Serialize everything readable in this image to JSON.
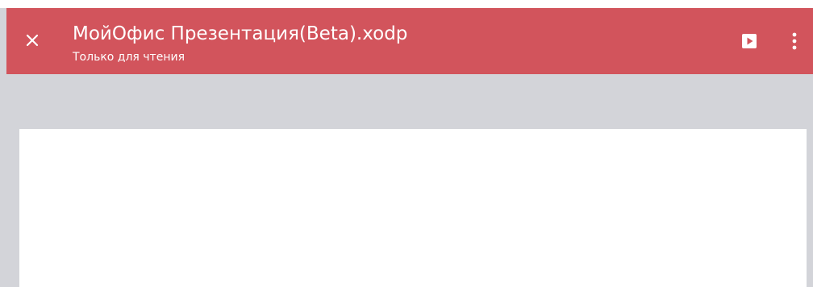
{
  "app_bar": {
    "title": "МойОфис Презентация(Beta).xodp",
    "subtitle": "Только для чтения",
    "color": "#d2545c",
    "close_icon": "close-icon",
    "play_icon": "play-icon",
    "more_icon": "more-vertical-icon"
  },
  "workspace": {
    "background": "#d3d4d9",
    "slide_background": "#ffffff"
  }
}
